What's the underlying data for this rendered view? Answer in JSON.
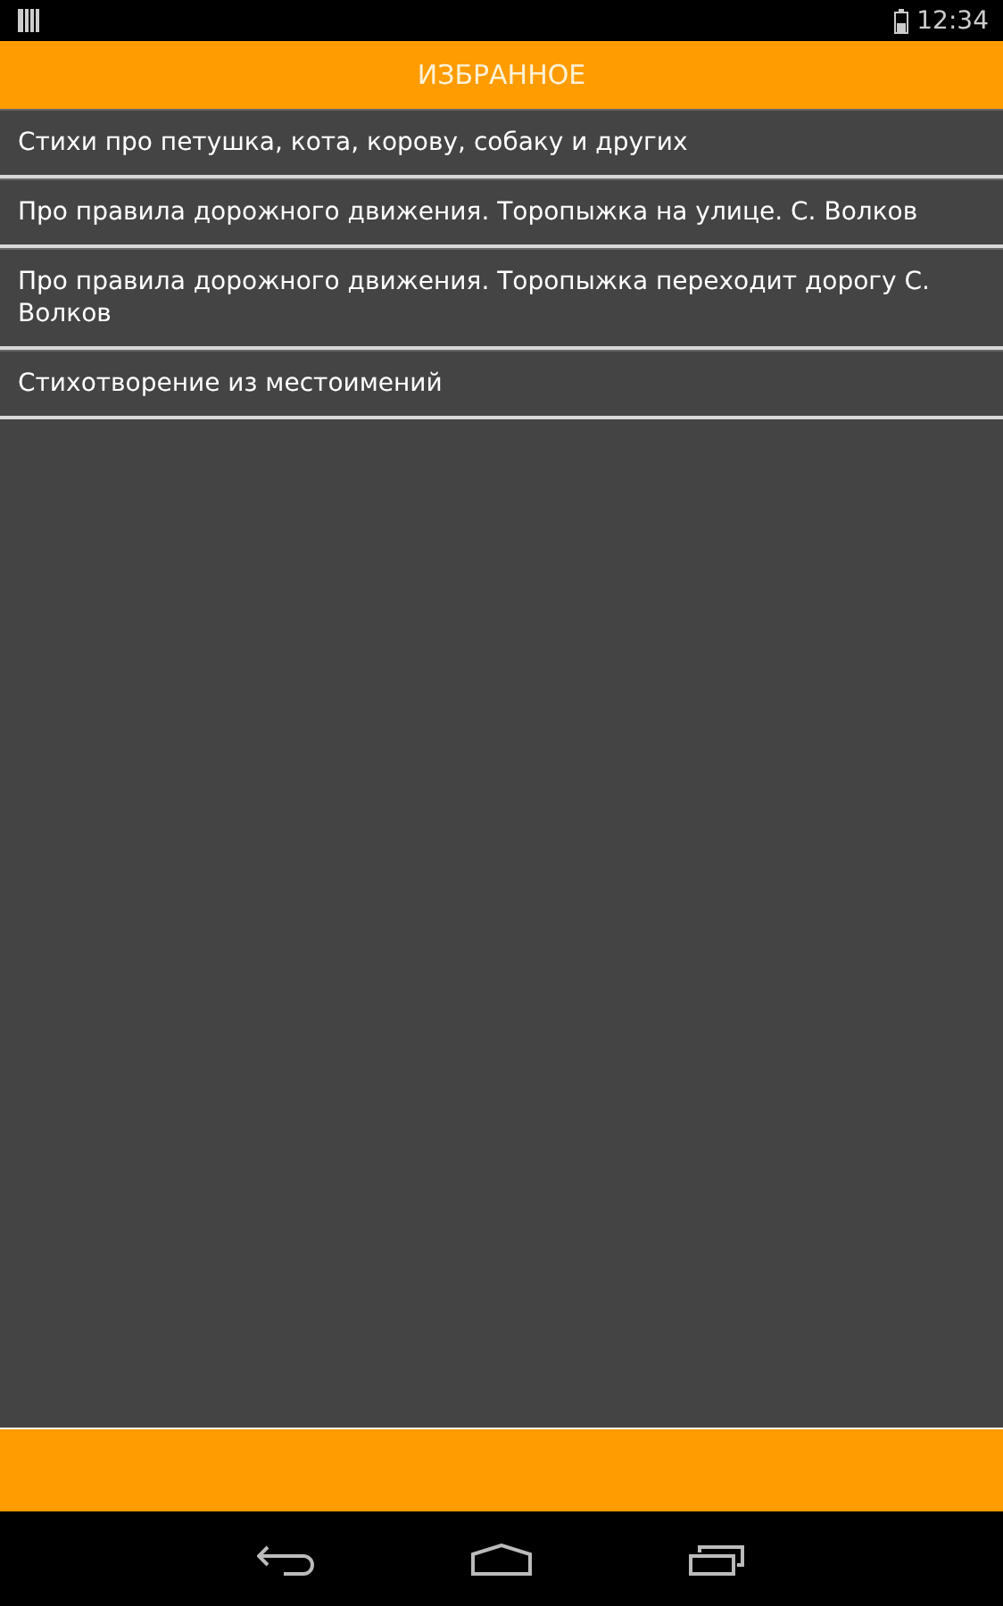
{
  "status_bar": {
    "time": "12:34"
  },
  "header": {
    "title": "ИЗБРАННОЕ"
  },
  "favorites": [
    {
      "title": "Стихи про петушка, кота, корову, собаку и других"
    },
    {
      "title": "Про правила дорожного движения. Торопыжка на улице. С. Волков"
    },
    {
      "title": "Про правила дорожного движения. Торопыжка переходит дорогу С. Волков"
    },
    {
      "title": "Стихотворение из местоимений"
    }
  ]
}
